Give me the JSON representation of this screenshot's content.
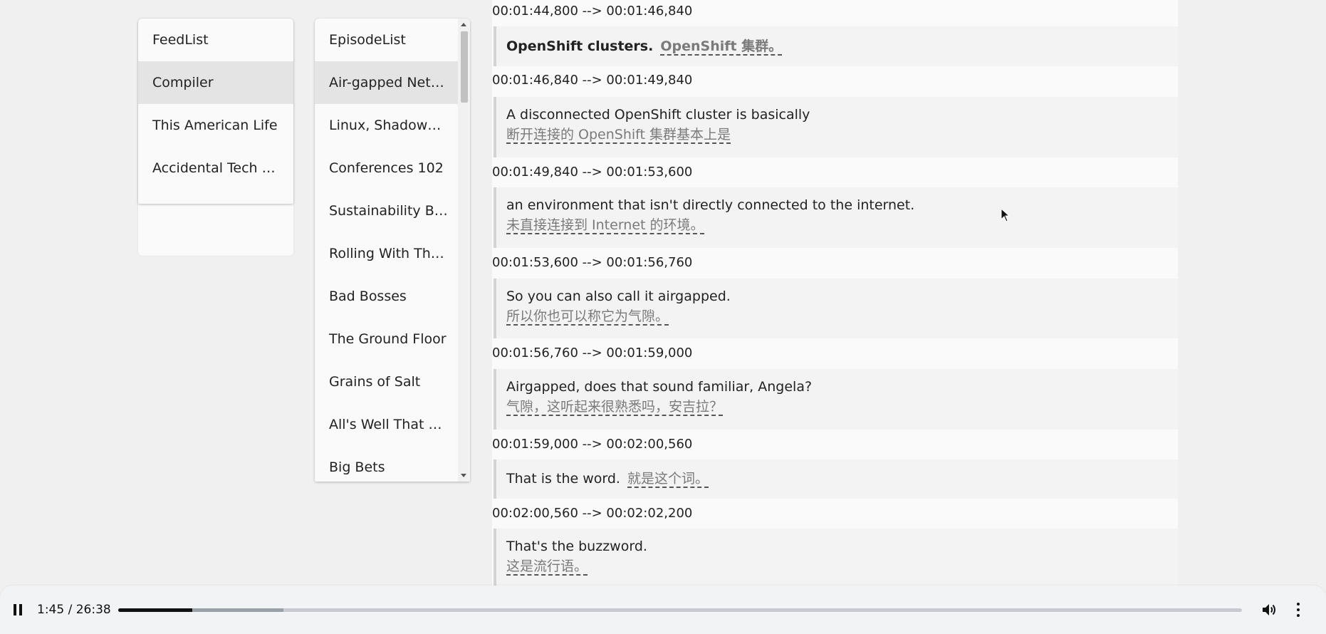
{
  "feeds": {
    "items": [
      {
        "label": "FeedList",
        "selected": false
      },
      {
        "label": "Compiler",
        "selected": true
      },
      {
        "label": "This American Life",
        "selected": false
      },
      {
        "label": "Accidental Tech P…",
        "selected": false
      }
    ]
  },
  "episodes": {
    "items": [
      {
        "label": "EpisodeList",
        "selected": false
      },
      {
        "label": "Air-gapped Net…",
        "selected": true
      },
      {
        "label": "Linux, Shadow…",
        "selected": false
      },
      {
        "label": "Conferences 102",
        "selected": false
      },
      {
        "label": "Sustainability B…",
        "selected": false
      },
      {
        "label": "Rolling With The…",
        "selected": false
      },
      {
        "label": "Bad Bosses",
        "selected": false
      },
      {
        "label": "The Ground Floor",
        "selected": false
      },
      {
        "label": "Grains of Salt",
        "selected": false
      },
      {
        "label": "All's Well That E…",
        "selected": false
      },
      {
        "label": "Big Bets",
        "selected": false
      }
    ]
  },
  "transcript": {
    "cues": [
      {
        "time": "00:01:44,800 --> 00:01:46,840",
        "en": "OpenShift clusters.",
        "zh": "OpenShift 集群。",
        "inline": true,
        "bold": true
      },
      {
        "time": "00:01:46,840 --> 00:01:49,840",
        "en": "A disconnected OpenShift cluster is basically",
        "zh": "断开连接的 OpenShift 集群基本上是",
        "inline": false,
        "bold": false
      },
      {
        "time": "00:01:49,840 --> 00:01:53,600",
        "en": "an environment that isn't directly connected to the internet.",
        "zh": "未直接连接到 Internet 的环境。",
        "inline": false,
        "bold": false
      },
      {
        "time": "00:01:53,600 --> 00:01:56,760",
        "en": "So you can also call it airgapped.",
        "zh": "所以你也可以称它为气隙。",
        "inline": false,
        "bold": false
      },
      {
        "time": "00:01:56,760 --> 00:01:59,000",
        "en": "Airgapped, does that sound familiar, Angela?",
        "zh": "气隙，这听起来很熟悉吗，安吉拉？",
        "inline": false,
        "bold": false
      },
      {
        "time": "00:01:59,000 --> 00:02:00,560",
        "en": "That is the word.",
        "zh": "就是这个词。",
        "inline": true,
        "bold": false
      },
      {
        "time": "00:02:00,560 --> 00:02:02,200",
        "en": "That's the buzzword.",
        "zh": "这是流行语。",
        "inline": false,
        "bold": false
      }
    ]
  },
  "player": {
    "time": "1:45 / 26:38",
    "played_fraction": 0.066,
    "buffered_fraction": 0.147,
    "pause_icon": "pause-icon",
    "volume_icon": "volume-icon",
    "more_icon": "more-options-icon"
  },
  "colors": {
    "selected_bg": "#e4e4e4",
    "cue_bg": "#f3f3f3",
    "cue_border": "#d3d3d3",
    "translation_text": "#7a7a7a"
  }
}
